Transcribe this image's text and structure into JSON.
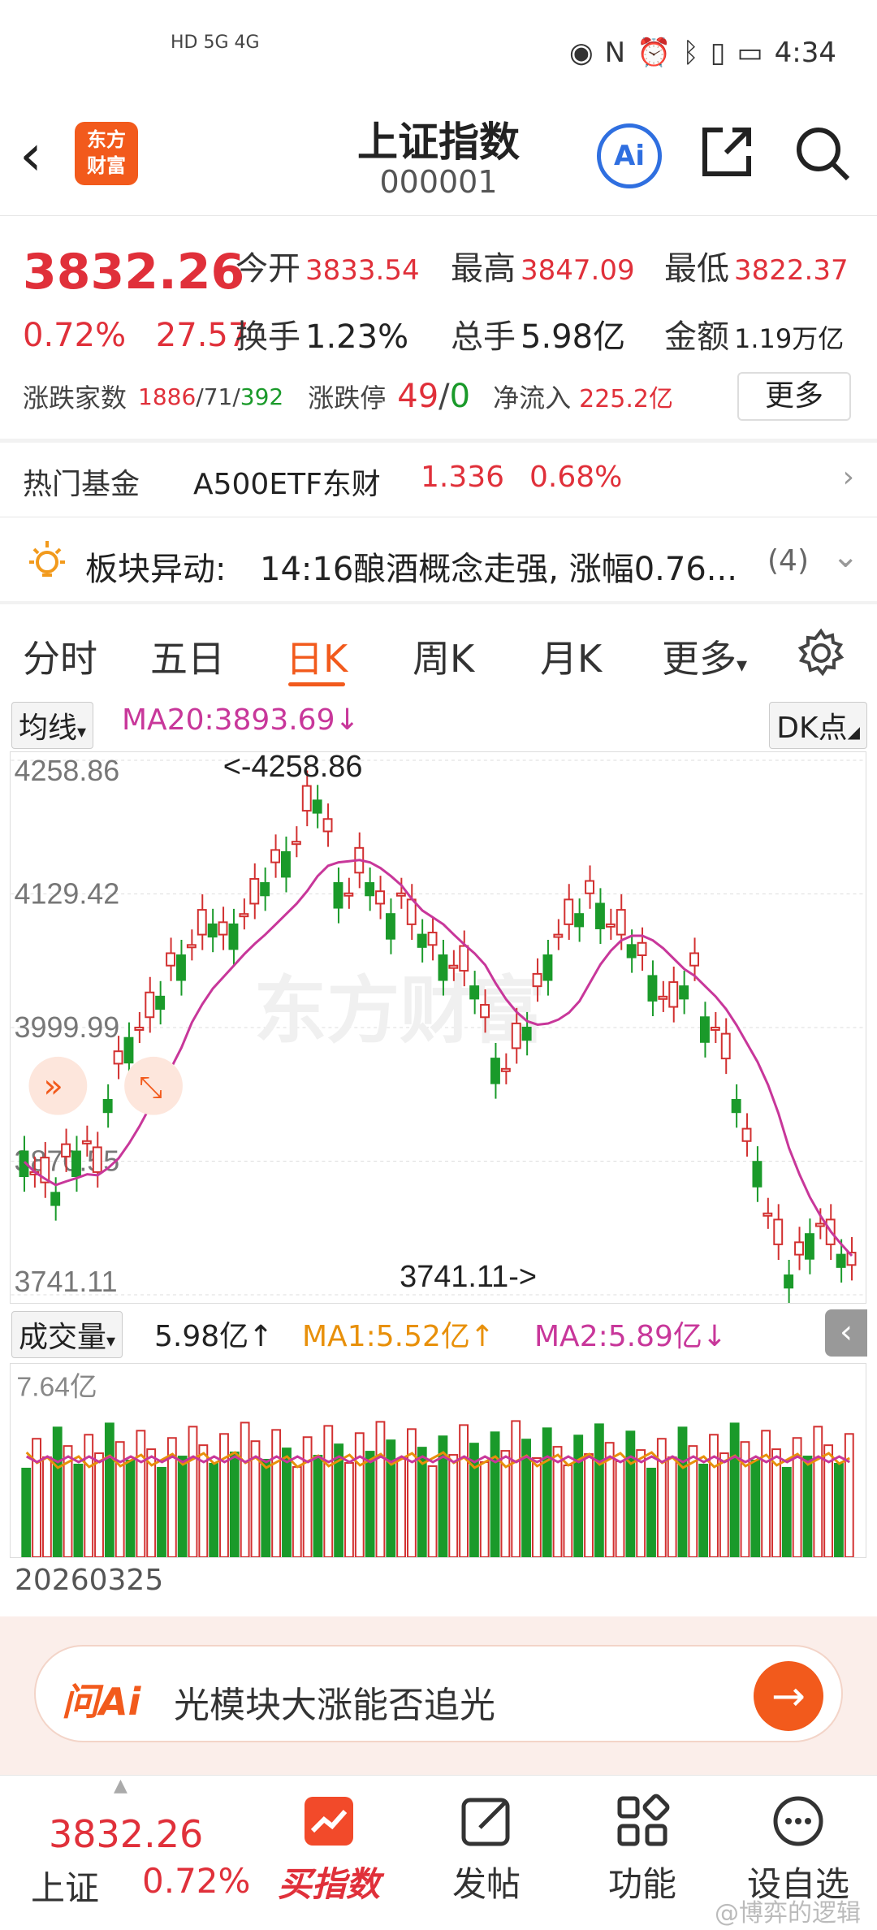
{
  "status_bar": {
    "net": "HD 5G 4G",
    "time": "4:34"
  },
  "header": {
    "title": "上证指数",
    "code": "000001",
    "logo_text_1": "东方",
    "logo_text_2": "财富",
    "ai_label": "Ai"
  },
  "quote": {
    "price": "3832.26",
    "change_pct": "0.72%",
    "change_pts": "27.57",
    "stats": [
      {
        "label": "今开",
        "value": "3833.54"
      },
      {
        "label": "最高",
        "value": "3847.09"
      },
      {
        "label": "最低",
        "value": "3822.37"
      },
      {
        "label": "换手",
        "value": "1.23%"
      },
      {
        "label": "总手",
        "value": "5.98亿"
      },
      {
        "label": "金额",
        "value": "1.19万亿"
      }
    ],
    "breadth_label": "涨跌家数",
    "breadth_up": "1886",
    "breadth_flat": "71",
    "breadth_down": "392",
    "limit_label": "涨跌停",
    "limit_up": "49",
    "limit_down": "0",
    "inflow_label": "净流入",
    "inflow_value": "225.2亿",
    "more_label": "更多"
  },
  "fund": {
    "label": "热门基金",
    "name": "A500ETF东财",
    "price": "1.336",
    "pct": "0.68%"
  },
  "sector": {
    "label": "板块异动:",
    "text": "14:16酿酒概念走强, 涨幅0.76...",
    "count": "(4)"
  },
  "tabs": [
    "分时",
    "五日",
    "日K",
    "周K",
    "月K",
    "更多"
  ],
  "active_tab": "日K",
  "chart_toolbar": {
    "ma_dropdown": "均线",
    "ma20": "MA20:3893.69",
    "dk_label": "DK点"
  },
  "vol_toolbar": {
    "dropdown": "成交量",
    "vol": "5.98亿",
    "ma1": "MA1:5.52亿",
    "ma2": "MA2:5.89亿"
  },
  "chart_data": {
    "type": "candlestick",
    "y_ticks": [
      "4258.86",
      "4129.42",
      "3999.99",
      "3870.55",
      "3741.11"
    ],
    "ylim": [
      3741.11,
      4258.86
    ],
    "high_annotation": "<-4258.86",
    "low_annotation": "3741.11->",
    "watermark": "东方财富",
    "volume_ylabel": "7.64亿",
    "date_left": "20260325",
    "colors": {
      "up": "#d23030",
      "down": "#1a9a2a",
      "ma20": "#c8379a",
      "ma1": "#e8900a",
      "ma2": "#c8379a"
    }
  },
  "ask": {
    "logo": "问Ai",
    "text": "光模块大涨能否追光"
  },
  "bottom_nav": {
    "price": "3832.26",
    "market": "上证",
    "pct": "0.72%",
    "items": [
      "买指数",
      "发帖",
      "功能",
      "设自选"
    ]
  },
  "watermark": "@博弈的逻辑"
}
